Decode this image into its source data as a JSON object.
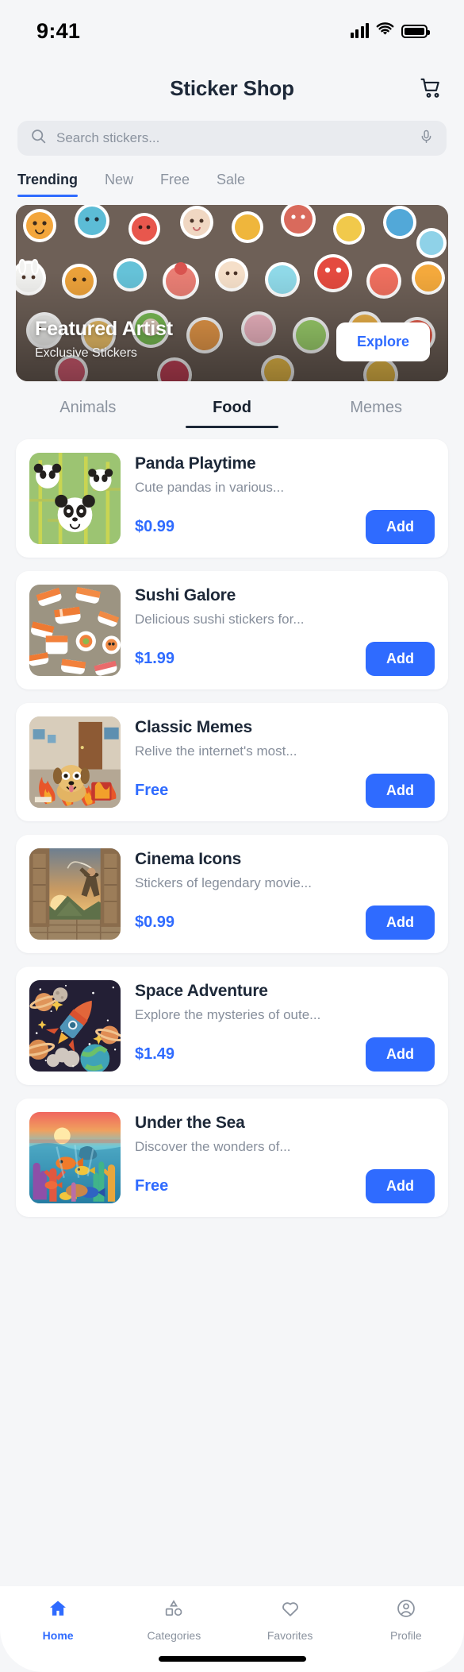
{
  "status_bar": {
    "time": "9:41",
    "signal_icon": "cellular-signal-icon",
    "wifi_icon": "wifi-icon",
    "battery_icon": "battery-icon"
  },
  "header": {
    "title": "Sticker Shop",
    "cart_icon": "shopping-cart-icon"
  },
  "search": {
    "placeholder": "Search stickers...",
    "value": "",
    "search_icon": "search-icon",
    "mic_icon": "microphone-icon"
  },
  "filter_tabs": {
    "active_index": 0,
    "items": [
      {
        "label": "Trending"
      },
      {
        "label": "New"
      },
      {
        "label": "Free"
      },
      {
        "label": "Sale"
      }
    ]
  },
  "hero": {
    "title": "Featured Artist",
    "subtitle": "Exclusive Stickers",
    "cta_label": "Explore",
    "art_name": "sticker-collage-photo"
  },
  "category_tabs": {
    "active_index": 1,
    "items": [
      {
        "label": "Animals"
      },
      {
        "label": "Food"
      },
      {
        "label": "Memes"
      }
    ]
  },
  "products": [
    {
      "title": "Panda Playtime",
      "description": "Cute pandas in various...",
      "price": "$0.99",
      "add_label": "Add",
      "thumb_name": "panda-bamboo-thumbnail"
    },
    {
      "title": "Sushi Galore",
      "description": "Delicious sushi stickers for...",
      "price": "$1.99",
      "add_label": "Add",
      "thumb_name": "sushi-platter-thumbnail"
    },
    {
      "title": "Classic Memes",
      "description": "Relive the internet's most...",
      "price": "Free",
      "add_label": "Add",
      "thumb_name": "burning-room-dog-thumbnail"
    },
    {
      "title": "Cinema Icons",
      "description": "Stickers of legendary movie...",
      "price": "$0.99",
      "add_label": "Add",
      "thumb_name": "adventurer-temple-thumbnail"
    },
    {
      "title": "Space Adventure",
      "description": "Explore the mysteries of oute...",
      "price": "$1.49",
      "add_label": "Add",
      "thumb_name": "rocket-space-thumbnail"
    },
    {
      "title": "Under the Sea",
      "description": "Discover the wonders of...",
      "price": "Free",
      "add_label": "Add",
      "thumb_name": "coral-reef-thumbnail"
    }
  ],
  "bottom_nav": {
    "active_index": 0,
    "items": [
      {
        "label": "Home",
        "icon": "home-icon"
      },
      {
        "label": "Categories",
        "icon": "shapes-icon"
      },
      {
        "label": "Favorites",
        "icon": "heart-icon"
      },
      {
        "label": "Profile",
        "icon": "person-circle-icon"
      }
    ]
  },
  "colors": {
    "accent": "#2f6bff",
    "text_primary": "#1d2838",
    "text_secondary": "#868e9b",
    "background": "#f5f6f8",
    "card": "#ffffff"
  }
}
